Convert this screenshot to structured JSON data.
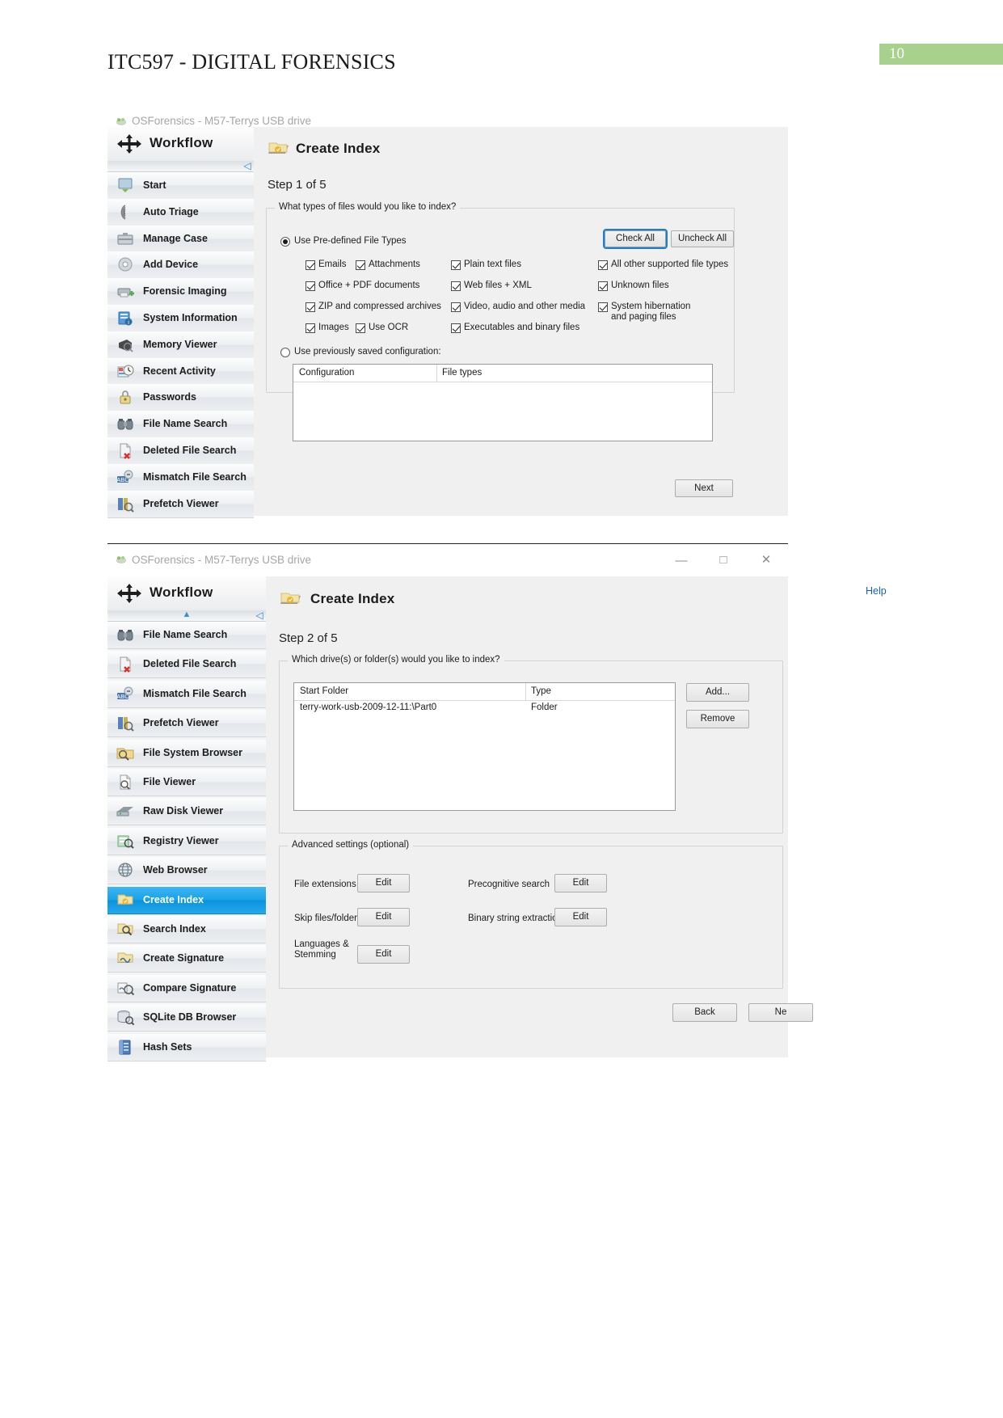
{
  "document": {
    "title": "ITC597 - DIGITAL FORENSICS",
    "page_number": "10",
    "badge_color": "#a9d18e"
  },
  "window1": {
    "app_title": "OSForensics - M57-Terrys USB drive",
    "app_icon": "osforensics-icon",
    "sidebar": {
      "header_label": "Workflow",
      "header_icon": "workflow-arrows-icon",
      "items": [
        {
          "label": "Start",
          "icon": "start-icon",
          "selected": false
        },
        {
          "label": "Auto Triage",
          "icon": "fingerprint-icon",
          "selected": false
        },
        {
          "label": "Manage Case",
          "icon": "briefcase-icon",
          "selected": false
        },
        {
          "label": "Add Device",
          "icon": "disk-icon",
          "selected": false
        },
        {
          "label": "Forensic Imaging",
          "icon": "imaging-icon",
          "selected": false
        },
        {
          "label": "System Information",
          "icon": "system-info-icon",
          "selected": false
        },
        {
          "label": "Memory Viewer",
          "icon": "memory-icon",
          "selected": false
        },
        {
          "label": "Recent Activity",
          "icon": "clock-icon",
          "selected": false
        },
        {
          "label": "Passwords",
          "icon": "padlock-key-icon",
          "selected": false
        },
        {
          "label": "File Name Search",
          "icon": "binoculars-icon",
          "selected": false
        },
        {
          "label": "Deleted File Search",
          "icon": "deleted-file-icon",
          "selected": false
        },
        {
          "label": "Mismatch File Search",
          "icon": "abc-mismatch-icon",
          "selected": false
        },
        {
          "label": "Prefetch Viewer",
          "icon": "prefetch-icon",
          "selected": false
        }
      ]
    },
    "panel": {
      "title": "Create Index",
      "icon": "create-index-folder-icon",
      "step": "Step 1 of 5",
      "groupbox_legend": "What types of files would you like to index?",
      "radio_predefined": {
        "label": "Use Pre-defined File Types",
        "selected": true
      },
      "radio_saved": {
        "label": "Use previously saved configuration:",
        "selected": false
      },
      "check_all_label": "Check All",
      "uncheck_all_label": "Uncheck All",
      "filetypes_col1": [
        {
          "label": "Emails",
          "checked": true
        },
        {
          "label": "Office + PDF documents",
          "checked": true
        },
        {
          "label": "ZIP and compressed archives",
          "checked": true
        },
        {
          "label": "Images",
          "checked": true
        }
      ],
      "filetypes_col1b": [
        {
          "label": "Attachments",
          "checked": true
        },
        {
          "label": "Use OCR",
          "checked": true
        }
      ],
      "filetypes_col2": [
        {
          "label": "Plain text files",
          "checked": true
        },
        {
          "label": "Web files + XML",
          "checked": true
        },
        {
          "label": "Video, audio and other media",
          "checked": true
        },
        {
          "label": "Executables and binary files",
          "checked": true
        }
      ],
      "filetypes_col3": [
        {
          "label": "All other supported file types",
          "checked": true
        },
        {
          "label": "Unknown files",
          "checked": true
        },
        {
          "label": "System hibernation and paging files",
          "checked": true
        }
      ],
      "config_table": {
        "columns": [
          "Configuration",
          "File types"
        ],
        "rows": []
      },
      "next_label": "Next"
    }
  },
  "window2": {
    "app_title": "OSForensics - M57-Terrys USB drive",
    "app_icon": "osforensics-icon",
    "controls": {
      "minimize": "—",
      "maximize": "□",
      "close": "✕"
    },
    "sidebar": {
      "header_label": "Workflow",
      "header_icon": "workflow-arrows-icon",
      "items": [
        {
          "label": "File Name Search",
          "icon": "binoculars-icon",
          "selected": false
        },
        {
          "label": "Deleted File Search",
          "icon": "deleted-file-icon",
          "selected": false
        },
        {
          "label": "Mismatch File Search",
          "icon": "abc-mismatch-icon",
          "selected": false
        },
        {
          "label": "Prefetch Viewer",
          "icon": "prefetch-icon",
          "selected": false
        },
        {
          "label": "File System Browser",
          "icon": "folder-search-icon",
          "selected": false
        },
        {
          "label": "File Viewer",
          "icon": "file-viewer-icon",
          "selected": false
        },
        {
          "label": "Raw Disk Viewer",
          "icon": "raw-disk-icon",
          "selected": false
        },
        {
          "label": "Registry Viewer",
          "icon": "registry-icon",
          "selected": false
        },
        {
          "label": "Web Browser",
          "icon": "web-browser-icon",
          "selected": false
        },
        {
          "label": "Create Index",
          "icon": "create-index-folder-icon",
          "selected": true
        },
        {
          "label": "Search Index",
          "icon": "search-index-icon",
          "selected": false
        },
        {
          "label": "Create Signature",
          "icon": "create-signature-icon",
          "selected": false
        },
        {
          "label": "Compare Signature",
          "icon": "compare-signature-icon",
          "selected": false
        },
        {
          "label": "SQLite DB Browser",
          "icon": "sqlite-icon",
          "selected": false
        },
        {
          "label": "Hash Sets",
          "icon": "hash-sets-icon",
          "selected": false
        }
      ]
    },
    "panel": {
      "title": "Create Index",
      "icon": "create-index-folder-icon",
      "step": "Step 2 of 5",
      "help_label": "Help",
      "groupbox_legend": "Which drive(s) or folder(s) would you like to index?",
      "folder_table": {
        "columns": [
          "Start Folder",
          "Type"
        ],
        "rows": [
          {
            "start_folder": "terry-work-usb-2009-12-11:\\Part0",
            "type": "Folder"
          }
        ]
      },
      "add_label": "Add...",
      "remove_label": "Remove",
      "advanced_legend": "Advanced settings (optional)",
      "advanced_rows": [
        {
          "label": "File extensions",
          "button": "Edit"
        },
        {
          "label": "Skip files/folders",
          "button": "Edit"
        },
        {
          "label": "Languages & Stemming",
          "button": "Edit"
        }
      ],
      "advanced_rows_right": [
        {
          "label": "Precognitive search",
          "button": "Edit"
        },
        {
          "label": "Binary string extraction",
          "button": "Edit"
        }
      ],
      "back_label": "Back",
      "next_label": "Ne"
    }
  }
}
